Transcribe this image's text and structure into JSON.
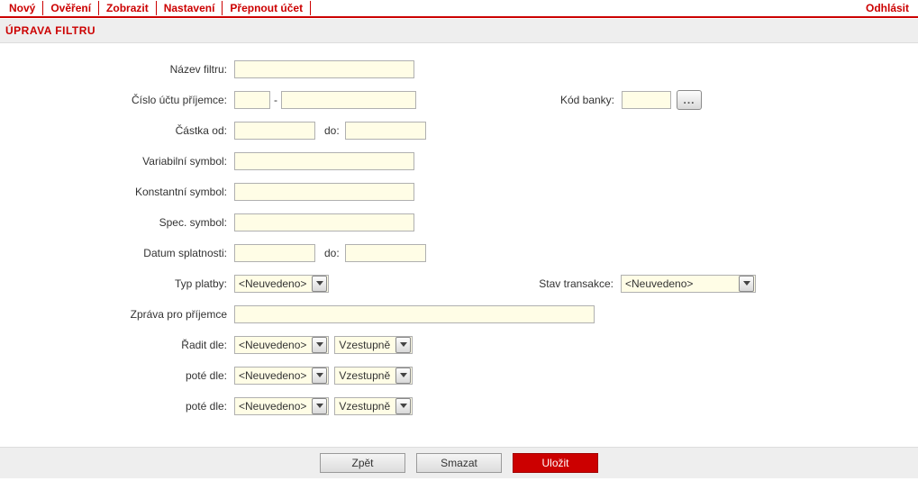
{
  "menu": {
    "items": [
      "Nový",
      "Ověření",
      "Zobrazit",
      "Nastavení",
      "Přepnout účet"
    ],
    "logout": "Odhlásit"
  },
  "section_title": "ÚPRAVA FILTRU",
  "labels": {
    "filter_name": "Název filtru:",
    "recipient_account": "Číslo účtu příjemce:",
    "bank_code": "Kód banky:",
    "amount_from": "Částka od:",
    "amount_to": "do:",
    "var_symbol": "Variabilní symbol:",
    "const_symbol": "Konstantní symbol:",
    "spec_symbol": "Spec. symbol:",
    "due_date": "Datum splatnosti:",
    "due_date_to": "do:",
    "payment_type": "Typ platby:",
    "trans_state": "Stav transakce:",
    "recipient_msg": "Zpráva pro příjemce",
    "sort_by": "Řadit dle:",
    "then_by1": "poté dle:",
    "then_by2": "poté dle:"
  },
  "values": {
    "filter_name": "",
    "acct_prefix": "",
    "acct_number": "",
    "bank_code": "",
    "amount_from": "",
    "amount_to": "",
    "var_symbol": "",
    "const_symbol": "",
    "spec_symbol": "",
    "due_from": "",
    "due_to": "",
    "recipient_msg": ""
  },
  "selects": {
    "not_specified": "<Neuvedeno>",
    "ascending": "Vzestupně"
  },
  "buttons": {
    "back": "Zpět",
    "clear": "Smazat",
    "save": "Uložit",
    "lookup": "..."
  }
}
